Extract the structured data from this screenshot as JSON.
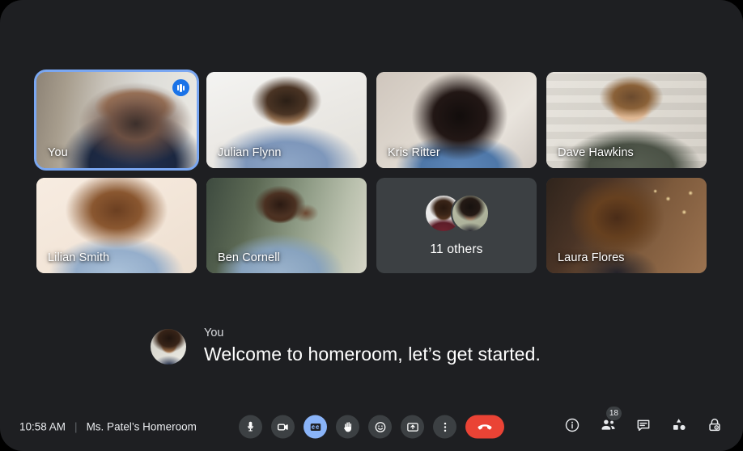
{
  "app": {
    "background": "#1e1f22",
    "accent": "#8ab4f8",
    "danger": "#ea4335",
    "active_speaker_border": "#7aa7f2"
  },
  "grid": {
    "tiles": [
      {
        "name": "You",
        "label": "You",
        "speaking": true,
        "active": true
      },
      {
        "name": "Julian Flynn",
        "label": "Julian Flynn",
        "speaking": false,
        "active": false
      },
      {
        "name": "Kris Ritter",
        "label": "Kris Ritter",
        "speaking": false,
        "active": false
      },
      {
        "name": "Dave Hawkins",
        "label": "Dave Hawkins",
        "speaking": false,
        "active": false
      },
      {
        "name": "Lilian Smith",
        "label": "Lilian Smith",
        "speaking": false,
        "active": false
      },
      {
        "name": "Ben Cornell",
        "label": "Ben Cornell",
        "speaking": false,
        "active": false
      },
      {
        "name": "overflow",
        "label": "11  others",
        "speaking": false,
        "active": false
      },
      {
        "name": "Laura Flores",
        "label": "Laura Flores",
        "speaking": false,
        "active": false
      }
    ],
    "overflow_count_label": "11  others"
  },
  "caption": {
    "speaker": "You",
    "text": "Welcome to homeroom, let’s get started."
  },
  "bottombar": {
    "time": "10:58 AM",
    "divider": "|",
    "meeting_name": "Ms. Patel’s Homeroom",
    "controls": [
      {
        "id": "microphone",
        "icon": "microphone-icon",
        "state": "off"
      },
      {
        "id": "camera",
        "icon": "video-camera-icon",
        "state": "off"
      },
      {
        "id": "captions",
        "icon": "closed-captions-icon",
        "state": "on"
      },
      {
        "id": "raise-hand",
        "icon": "raised-hand-icon",
        "state": "off"
      },
      {
        "id": "reactions",
        "icon": "emoji-smiley-icon",
        "state": "off"
      },
      {
        "id": "present",
        "icon": "present-screen-icon",
        "state": "off"
      },
      {
        "id": "more",
        "icon": "more-vertical-icon",
        "state": "off"
      },
      {
        "id": "hangup",
        "icon": "end-call-phone-icon",
        "state": "danger"
      }
    ],
    "right_controls": [
      {
        "id": "meeting-details",
        "icon": "info-circle-icon",
        "badge": ""
      },
      {
        "id": "participants",
        "icon": "people-icon",
        "badge": "18"
      },
      {
        "id": "chat",
        "icon": "chat-bubble-icon",
        "badge": ""
      },
      {
        "id": "activities",
        "icon": "activities-shapes-icon",
        "badge": ""
      },
      {
        "id": "host-controls",
        "icon": "lock-host-icon",
        "badge": ""
      }
    ]
  }
}
